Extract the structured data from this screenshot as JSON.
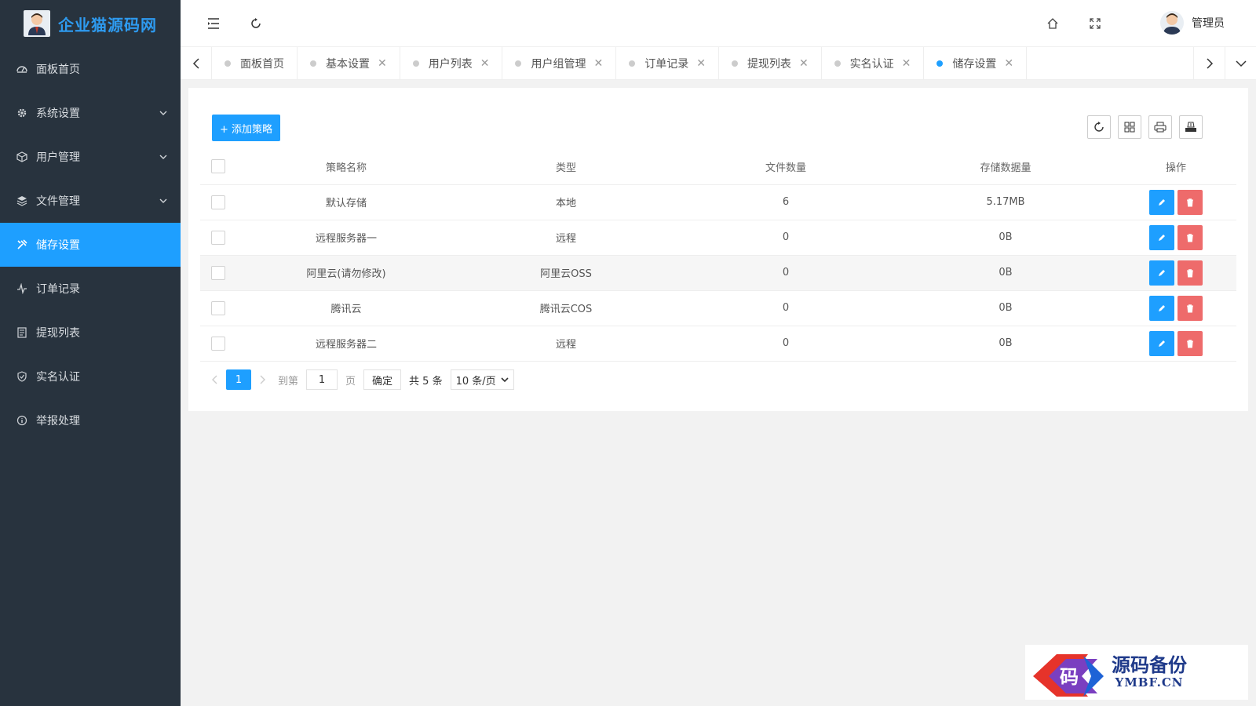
{
  "brand": {
    "name": "企业猫源码网",
    "avatar_icon": "admin-avatar-icon"
  },
  "sidebar": {
    "items": [
      {
        "label": "面板首页",
        "icon": "dashboard-icon",
        "has_arrow": false
      },
      {
        "label": "系统设置",
        "icon": "gear-icon",
        "has_arrow": true
      },
      {
        "label": "用户管理",
        "icon": "cube-icon",
        "has_arrow": true
      },
      {
        "label": "文件管理",
        "icon": "layers-icon",
        "has_arrow": true
      },
      {
        "label": "储存设置",
        "icon": "tools-icon",
        "has_arrow": false,
        "active": true
      },
      {
        "label": "订单记录",
        "icon": "pulse-icon",
        "has_arrow": false
      },
      {
        "label": "提现列表",
        "icon": "list-doc-icon",
        "has_arrow": false
      },
      {
        "label": "实名认证",
        "icon": "shield-check-icon",
        "has_arrow": false
      },
      {
        "label": "举报处理",
        "icon": "info-circle-icon",
        "has_arrow": false
      }
    ]
  },
  "header": {
    "user_name": "管理员"
  },
  "tabs": [
    {
      "label": "面板首页",
      "closable": false
    },
    {
      "label": "基本设置",
      "closable": true
    },
    {
      "label": "用户列表",
      "closable": true
    },
    {
      "label": "用户组管理",
      "closable": true
    },
    {
      "label": "订单记录",
      "closable": true
    },
    {
      "label": "提现列表",
      "closable": true
    },
    {
      "label": "实名认证",
      "closable": true
    },
    {
      "label": "储存设置",
      "closable": true,
      "active": true
    }
  ],
  "toolbar": {
    "add_label": "+ 添加策略"
  },
  "table": {
    "headers": [
      "策略名称",
      "类型",
      "文件数量",
      "存储数据量",
      "操作"
    ],
    "rows": [
      {
        "name": "默认存储",
        "type": "本地",
        "count": "6",
        "size": "5.17MB"
      },
      {
        "name": "远程服务器一",
        "type": "远程",
        "count": "0",
        "size": "0B"
      },
      {
        "name": "阿里云(请勿修改)",
        "type": "阿里云OSS",
        "count": "0",
        "size": "0B"
      },
      {
        "name": "腾讯云",
        "type": "腾讯云COS",
        "count": "0",
        "size": "0B"
      },
      {
        "name": "远程服务器二",
        "type": "远程",
        "count": "0",
        "size": "0B"
      }
    ]
  },
  "pager": {
    "current": "1",
    "goto_label": "到第",
    "goto_value": "1",
    "page_label": "页",
    "confirm_label": "确定",
    "total_label": "共 5 条",
    "per_page": "10 条/页"
  },
  "watermark": {
    "main": "源码备份",
    "sub": "YMBF.CN",
    "glyph": "码"
  },
  "colors": {
    "sidebar_bg": "#28333e",
    "accent": "#1e9fff",
    "danger": "#ee6b6b",
    "brand_text": "#2e9bf0"
  }
}
